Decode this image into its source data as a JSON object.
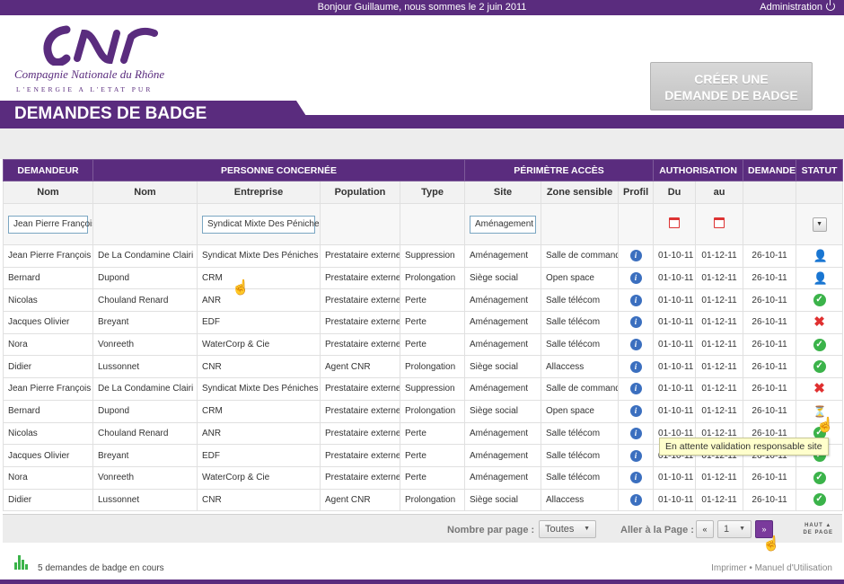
{
  "topbar": {
    "greeting": "Bonjour Guillaume, nous sommes le 2 juin 2011",
    "admin_label": "Administration",
    "power_icon": "power-icon"
  },
  "logo": {
    "name": "Compagnie Nationale du Rhône",
    "tagline": "L'ENERGIE A L'ETAT PUR"
  },
  "create_button": {
    "line1": "CRÉER UNE",
    "line2": "DEMANDE  DE BADGE"
  },
  "page_title": "DEMANDES DE BADGE",
  "groups": [
    "DEMANDEUR",
    "PERSONNE CONCERNÉE",
    "PÉRIMÈTRE ACCÈS",
    "AUTHORISATION",
    "DEMANDE",
    "STATUT"
  ],
  "columns": [
    "Nom",
    "Nom",
    "Entreprise",
    "Population",
    "Type",
    "Site",
    "Zone sensible",
    "Profil",
    "Du",
    "au",
    "",
    ""
  ],
  "filters": {
    "demandeur": "Jean Pierre François",
    "entreprise": "Syndicat Mixte Des Péniches",
    "site": "Aménagement"
  },
  "rows": [
    {
      "dem": "Jean Pierre François",
      "nom": "De La Condamine Clairi",
      "ent": "Syndicat Mixte Des Péniches",
      "pop": "Prestataire externe",
      "type": "Suppression",
      "site": "Aménagement",
      "zone": "Salle de commande",
      "du": "01-10-11",
      "au": "01-12-11",
      "dem_date": "26-10-11",
      "status": "user"
    },
    {
      "dem": "Bernard",
      "nom": "Dupond",
      "ent": "CRM",
      "pop": "Prestataire externe",
      "type": "Prolongation",
      "site": "Siège social",
      "zone": "Open space",
      "du": "01-10-11",
      "au": "01-12-11",
      "dem_date": "26-10-11",
      "status": "user"
    },
    {
      "dem": "Nicolas",
      "nom": "Chouland Renard",
      "ent": "ANR",
      "pop": "Prestataire externe",
      "type": "Perte",
      "site": "Aménagement",
      "zone": "Salle télécom",
      "du": "01-10-11",
      "au": "01-12-11",
      "dem_date": "26-10-11",
      "status": "ok"
    },
    {
      "dem": "Jacques Olivier",
      "nom": "Breyant",
      "ent": "EDF",
      "pop": "Prestataire externe",
      "type": "Perte",
      "site": "Aménagement",
      "zone": "Salle télécom",
      "du": "01-10-11",
      "au": "01-12-11",
      "dem_date": "26-10-11",
      "status": "ko"
    },
    {
      "dem": "Nora",
      "nom": "Vonreeth",
      "ent": "WaterCorp & Cie",
      "pop": "Prestataire externe",
      "type": "Perte",
      "site": "Aménagement",
      "zone": "Salle télécom",
      "du": "01-10-11",
      "au": "01-12-11",
      "dem_date": "26-10-11",
      "status": "ok"
    },
    {
      "dem": "Didier",
      "nom": "Lussonnet",
      "ent": "CNR",
      "pop": "Agent CNR",
      "type": "Prolongation",
      "site": "Siège social",
      "zone": "Allaccess",
      "du": "01-10-11",
      "au": "01-12-11",
      "dem_date": "26-10-11",
      "status": "ok"
    },
    {
      "dem": "Jean Pierre François",
      "nom": "De La Condamine Clairi",
      "ent": "Syndicat Mixte Des Péniches",
      "pop": "Prestataire externe",
      "type": "Suppression",
      "site": "Aménagement",
      "zone": "Salle de commande",
      "du": "01-10-11",
      "au": "01-12-11",
      "dem_date": "26-10-11",
      "status": "ko"
    },
    {
      "dem": "Bernard",
      "nom": "Dupond",
      "ent": "CRM",
      "pop": "Prestataire externe",
      "type": "Prolongation",
      "site": "Siège social",
      "zone": "Open space",
      "du": "01-10-11",
      "au": "01-12-11",
      "dem_date": "26-10-11",
      "status": "wait"
    },
    {
      "dem": "Nicolas",
      "nom": "Chouland Renard",
      "ent": "ANR",
      "pop": "Prestataire externe",
      "type": "Perte",
      "site": "Aménagement",
      "zone": "Salle télécom",
      "du": "01-10-11",
      "au": "01-12-11",
      "dem_date": "26-10-11",
      "status": "ok"
    },
    {
      "dem": "Jacques Olivier",
      "nom": "Breyant",
      "ent": "EDF",
      "pop": "Prestataire externe",
      "type": "Perte",
      "site": "Aménagement",
      "zone": "Salle télécom",
      "du": "01-10-11",
      "au": "01-12-11",
      "dem_date": "26-10-11",
      "status": "ok"
    },
    {
      "dem": "Nora",
      "nom": "Vonreeth",
      "ent": "WaterCorp & Cie",
      "pop": "Prestataire externe",
      "type": "Perte",
      "site": "Aménagement",
      "zone": "Salle télécom",
      "du": "01-10-11",
      "au": "01-12-11",
      "dem_date": "26-10-11",
      "status": "ok"
    },
    {
      "dem": "Didier",
      "nom": "Lussonnet",
      "ent": "CNR",
      "pop": "Agent CNR",
      "type": "Prolongation",
      "site": "Siège social",
      "zone": "Allaccess",
      "du": "01-10-11",
      "au": "01-12-11",
      "dem_date": "26-10-11",
      "status": "ok"
    }
  ],
  "tooltip": "En attente validation responsable site",
  "pager": {
    "per_page_label": "Nombre par page :",
    "per_page_value": "Toutes",
    "goto_label": "Aller à la Page :",
    "page": "1",
    "prev": "«",
    "next": "»",
    "top_line1": "HAUT",
    "top_line2": "DE PAGE"
  },
  "footer": {
    "summary": "5 demandes de badge en cours",
    "links": "Imprimer • Manuel d'Utilisation"
  }
}
